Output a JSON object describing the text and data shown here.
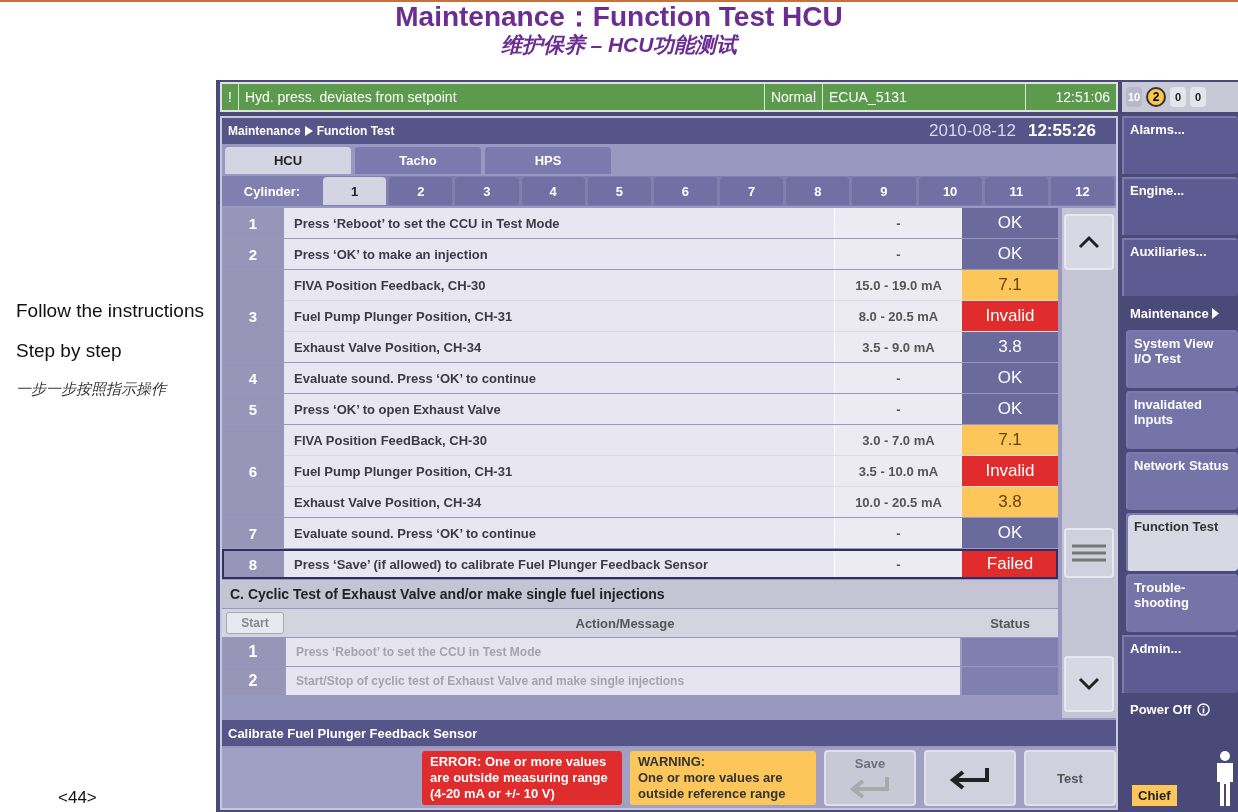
{
  "slide": {
    "title": "Maintenance：Function Test HCU",
    "subtitle": "维护保养 – HCU功能测试",
    "notes": [
      "Follow the instructions",
      "Step by step",
      "一步一步按照指示操作"
    ],
    "page_number": "<44>"
  },
  "alarm_bar": {
    "icon": "!",
    "message": "Hyd. press. deviates from setpoint",
    "mode": "Normal",
    "unit": "ECUA_5131",
    "time": "12:51:06",
    "counters": [
      {
        "text": "10",
        "kind": "plain"
      },
      {
        "text": "2",
        "kind": "warning"
      },
      {
        "text": "0",
        "kind": "count"
      },
      {
        "text": "0",
        "kind": "count"
      }
    ]
  },
  "header": {
    "breadcrumb": [
      "Maintenance",
      "Function Test"
    ],
    "date": "2010-08-12",
    "time": "12:55:26"
  },
  "tabs": [
    {
      "label": "HCU",
      "selected": true
    },
    {
      "label": "Tacho",
      "selected": false
    },
    {
      "label": "HPS",
      "selected": false
    }
  ],
  "cylinder": {
    "label": "Cylinder:",
    "tabs": [
      {
        "label": "1",
        "selected": true
      },
      {
        "label": "2",
        "selected": false
      },
      {
        "label": "3",
        "selected": false
      },
      {
        "label": "4",
        "selected": false
      },
      {
        "label": "5",
        "selected": false
      },
      {
        "label": "6",
        "selected": false
      },
      {
        "label": "7",
        "selected": false
      },
      {
        "label": "8",
        "selected": false
      },
      {
        "label": "9",
        "selected": false
      },
      {
        "label": "10",
        "selected": false
      },
      {
        "label": "11",
        "selected": false
      },
      {
        "label": "12",
        "selected": false
      }
    ]
  },
  "steps": [
    {
      "number": "1",
      "selected": false,
      "lines": [
        {
          "text": "Press ‘Reboot’ to set the CCU in Test Mode",
          "range": "-",
          "status": "OK",
          "kind": "ok"
        }
      ]
    },
    {
      "number": "2",
      "selected": false,
      "lines": [
        {
          "text": "Press ‘OK’ to make an injection",
          "range": "-",
          "status": "OK",
          "kind": "ok"
        }
      ]
    },
    {
      "number": "3",
      "selected": false,
      "lines": [
        {
          "text": "FIVA Position Feedback, CH-30",
          "range": "15.0 - 19.0 mA",
          "status": "7.1",
          "kind": "warning"
        },
        {
          "text": "Fuel Pump Plunger Position, CH-31",
          "range": "8.0 - 20.5 mA",
          "status": "Invalid",
          "kind": "error"
        },
        {
          "text": "Exhaust Valve Position, CH-34",
          "range": "3.5 - 9.0 mA",
          "status": "3.8",
          "kind": "ok"
        }
      ]
    },
    {
      "number": "4",
      "selected": false,
      "lines": [
        {
          "text": "Evaluate sound. Press ‘OK’ to continue",
          "range": "-",
          "status": "OK",
          "kind": "ok"
        }
      ]
    },
    {
      "number": "5",
      "selected": false,
      "lines": [
        {
          "text": "Press ‘OK’ to open Exhaust Valve",
          "range": "-",
          "status": "OK",
          "kind": "ok"
        }
      ]
    },
    {
      "number": "6",
      "selected": false,
      "lines": [
        {
          "text": "FIVA Position FeedBack, CH-30",
          "range": "3.0 - 7.0 mA",
          "status": "7.1",
          "kind": "warning"
        },
        {
          "text": "Fuel Pump Plunger Position, CH-31",
          "range": "3.5 - 10.0 mA",
          "status": "Invalid",
          "kind": "error"
        },
        {
          "text": "Exhaust Valve Position, CH-34",
          "range": "10.0 - 20.5 mA",
          "status": "3.8",
          "kind": "warning"
        }
      ]
    },
    {
      "number": "7",
      "selected": false,
      "lines": [
        {
          "text": "Evaluate sound. Press ‘OK’ to continue",
          "range": "-",
          "status": "OK",
          "kind": "ok"
        }
      ]
    },
    {
      "number": "8",
      "selected": true,
      "lines": [
        {
          "text": "Press ‘Save’ (if allowed) to calibrate Fuel Plunger Feedback Sensor",
          "range": "-",
          "status": "Failed",
          "kind": "error"
        }
      ]
    }
  ],
  "cyclic": {
    "title": "C. Cyclic Test of Exhaust Valve and/or make single fuel injections",
    "start_button": "Start",
    "columns": [
      "Action/Message",
      "Status"
    ],
    "rows": [
      {
        "number": "1",
        "text": "Press ‘Reboot’ to set the CCU in Test Mode",
        "disabled": true
      },
      {
        "number": "2",
        "text": "Start/Stop of cyclic test of Exhaust Valve and make single injections",
        "disabled": true
      }
    ]
  },
  "footer": {
    "title": "Calibrate Fuel Plunger Feedback Sensor",
    "error": "ERROR: One or more values are outside measuring range (4-20 mA or +/- 10 V)",
    "warning_title": "WARNING:",
    "warning": "One or more values are outside reference range",
    "buttons": [
      {
        "kind": "save",
        "label": "Save",
        "disabled": true
      },
      {
        "kind": "enter",
        "disabled": false
      },
      {
        "kind": "test",
        "label": "Test",
        "disabled": false
      }
    ]
  },
  "nav": [
    {
      "label": "Alarms...",
      "kind": "item",
      "selected": false
    },
    {
      "label": "Engine...",
      "kind": "item",
      "selected": false
    },
    {
      "label": "Auxiliaries...",
      "kind": "item",
      "selected": false
    },
    {
      "label": "Maintenance",
      "kind": "header"
    },
    {
      "label": "System View I/O Test",
      "kind": "sub",
      "selected": false
    },
    {
      "label": "Invalidated Inputs",
      "kind": "sub",
      "selected": false
    },
    {
      "label": "Network Status",
      "kind": "sub",
      "selected": false
    },
    {
      "label": "Function Test",
      "kind": "sub",
      "selected": true
    },
    {
      "label": "Trouble-shooting",
      "kind": "sub",
      "selected": false
    },
    {
      "label": "Admin...",
      "kind": "item",
      "selected": false
    }
  ],
  "power": {
    "label": "Power Off"
  },
  "access": {
    "role": "Chief"
  }
}
